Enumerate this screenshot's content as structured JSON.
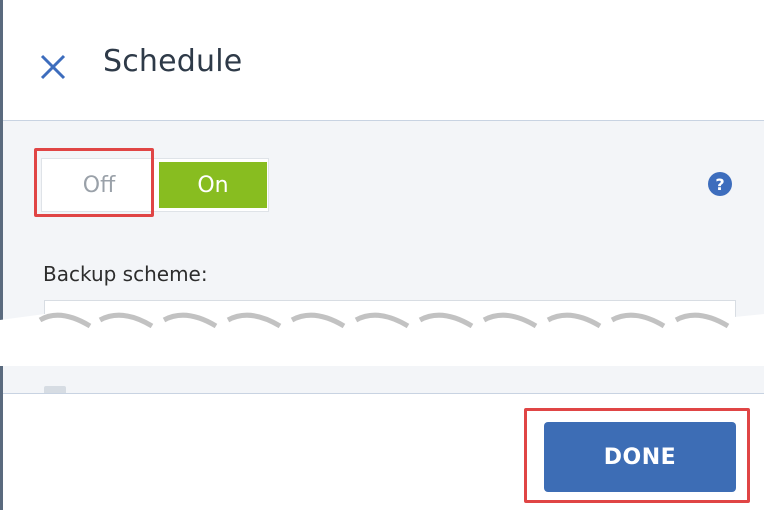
{
  "dialog": {
    "title": "Schedule"
  },
  "schedule_toggle": {
    "off_label": "Off",
    "on_label": "On",
    "selected": "On"
  },
  "backup_scheme": {
    "label": "Backup scheme:",
    "value": ""
  },
  "footer": {
    "done_label": "DONE"
  },
  "colors": {
    "accent_blue": "#3d6db5",
    "toggle_on": "#88bd20",
    "highlight_red": "#e04545"
  },
  "icons": {
    "close": "close-icon",
    "help": "help-icon"
  }
}
